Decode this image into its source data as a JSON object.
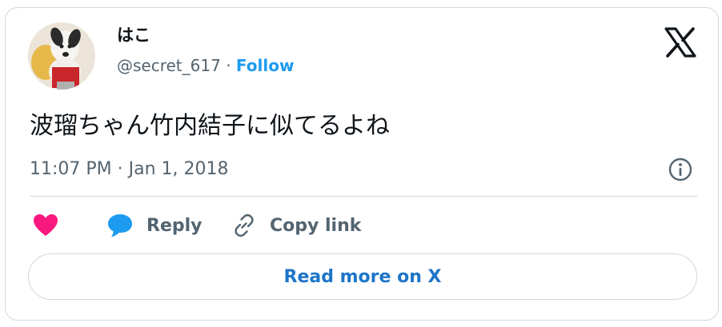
{
  "author": {
    "display_name": "はこ",
    "handle": "@secret_617",
    "separator": "·",
    "follow_label": "Follow"
  },
  "tweet": {
    "text": "波瑠ちゃん竹内結子に似てるよね",
    "timestamp": "11:07 PM · Jan 1, 2018"
  },
  "actions": {
    "reply_label": "Reply",
    "copy_link_label": "Copy link"
  },
  "read_more_label": "Read more on X",
  "icons": {
    "brand": "x-logo-icon",
    "info": "info-icon",
    "like": "heart-icon",
    "reply": "speech-bubble-icon",
    "copy": "link-icon"
  },
  "colors": {
    "accent": "#1d9bf0",
    "like": "#f91880",
    "text": "#0f1419",
    "secondary": "#536471",
    "border": "#cfd9de"
  }
}
